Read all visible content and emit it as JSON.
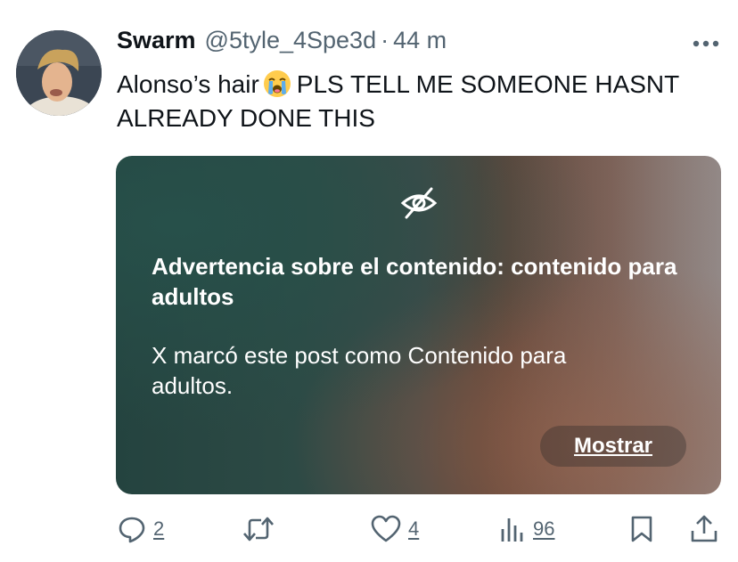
{
  "post": {
    "author_name": "Swarm",
    "author_handle": "@5tyle_4Spe3d",
    "separator": "·",
    "timestamp": "44 m",
    "text_before_emoji": "Alonso’s hair",
    "emoji": "loudly-crying-face",
    "text_after_emoji": "PLS TELL ME SOMEONE HASNT ALREADY DONE THIS"
  },
  "content_warning": {
    "icon": "eye-slash-icon",
    "title": "Advertencia sobre el contenido: contenido para adultos",
    "description": "X marcó este post como Contenido para adultos.",
    "show_button": "Mostrar"
  },
  "actions": {
    "reply_count": "2",
    "like_count": "4",
    "views_count": "96"
  },
  "colors": {
    "text": "#0f1419",
    "secondary_text": "#536471",
    "action_icon": "#536471"
  }
}
